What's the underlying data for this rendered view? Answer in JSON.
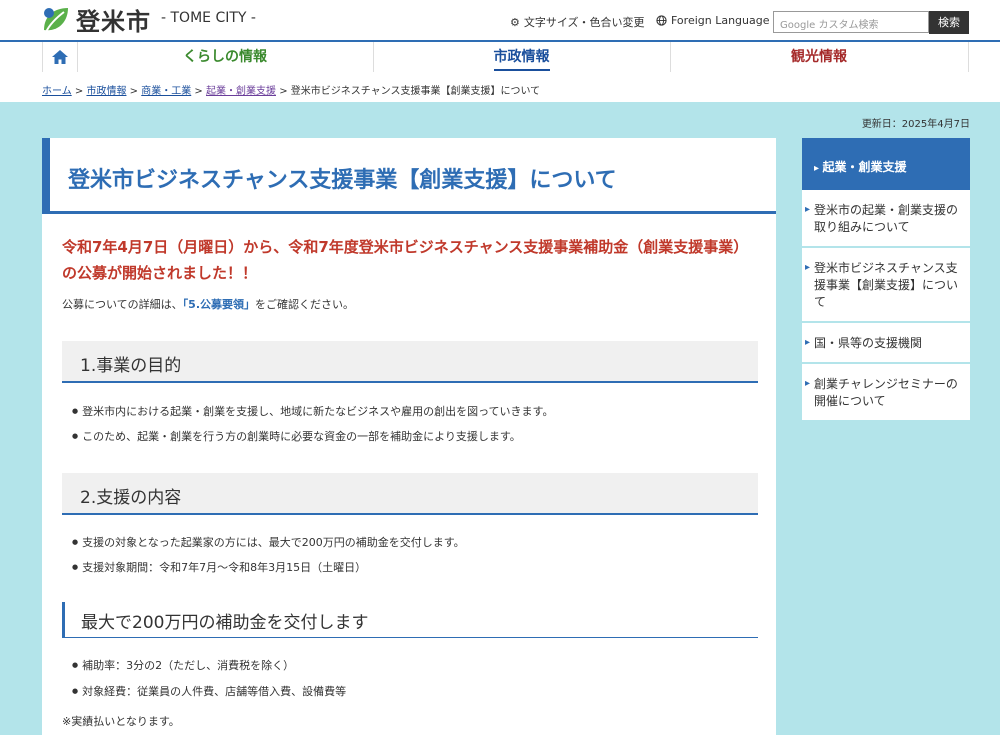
{
  "header": {
    "logo_text": "登米市",
    "logo_sub": "- TOME CITY -",
    "font_color": "文字サイズ・色合い変更",
    "foreign": "Foreign Language",
    "search_placeholder": "Google カスタム検索",
    "search_button": "検索"
  },
  "nav": {
    "items": [
      {
        "label": "くらしの情報",
        "color": "#3b8a2e"
      },
      {
        "label": "市政情報",
        "color": "#1a4f9c"
      },
      {
        "label": "観光情報",
        "color": "#a52a2a"
      }
    ]
  },
  "breadcrumb": {
    "items": [
      "ホーム",
      "市政情報",
      "商業・工業",
      "起業・創業支援"
    ],
    "current": "登米市ビジネスチャンス支援事業【創業支援】について",
    "sep": ">"
  },
  "updated": "更新日：2025年4月7日",
  "main": {
    "title": "登米市ビジネスチャンス支援事業【創業支援】について",
    "announcement": "令和7年4月7日（月曜日）から、令和7年度登米市ビジネスチャンス支援事業補助金（創業支援事業）の公募が開始されました！！",
    "intro_pre": "公募についての詳細は、",
    "intro_link": "「5.公募要領」",
    "intro_post": "をご確認ください。",
    "s1_title": "1.事業の目的",
    "s1_items": [
      "登米市内における起業・創業を支援し、地域に新たなビジネスや雇用の創出を図っていきます。",
      "このため、起業・創業を行う方の創業時に必要な資金の一部を補助金により支援します。"
    ],
    "s2_title": "2.支援の内容",
    "s2_items": [
      "支援の対象となった起業家の方には、最大で200万円の補助金を交付します。",
      "支援対象期間：令和7年7月～令和8年3月15日（土曜日）"
    ],
    "s3_title": "最大で200万円の補助金を交付します",
    "s3_items": [
      "補助率：3分の2（ただし、消費税を除く）",
      "対象経費：従業員の人件費、店舗等借入費、設備費等"
    ],
    "note": "※実績払いとなります。"
  },
  "sidebar": {
    "head": "起業・創業支援",
    "items": [
      "登米市の起業・創業支援の取り組みについて",
      "登米市ビジネスチャンス支援事業【創業支援】について",
      "国・県等の支援機関",
      "創業チャレンジセミナーの開催について"
    ]
  }
}
